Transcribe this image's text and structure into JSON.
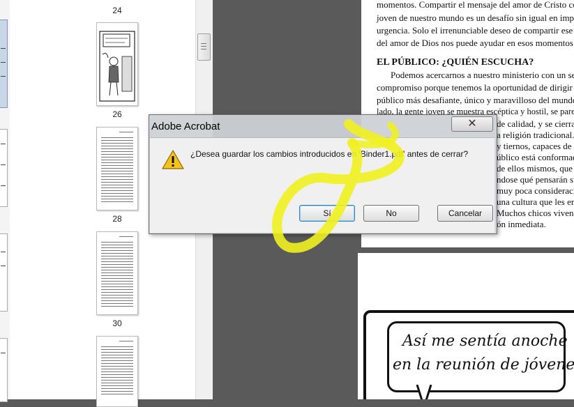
{
  "thumbnails": {
    "page_numbers": [
      "24",
      "26",
      "28",
      "30"
    ]
  },
  "document": {
    "top_lines": [
      "momentos. Compartir el mensaje del amor de Cristo con l",
      "joven de nuestro mundo es un desafío sin igual en import",
      "urgencia. Solo el irrenunciable deseo de compartir ese n",
      "del amor de Dios nos puede ayudar en esos momentos."
    ],
    "heading": "EL PÚBLICO: ¿QUIÉN ESCUCHA?",
    "body_lines": [
      "Podemos acercarnos a nuestro ministerio con un sent",
      "compromiso porque tenemos la oportunidad de dirigir",
      "público más desafiante, único y maravilloso del mundo.",
      "lado, la gente joven se muestra escéptica y hostil, se parec",
      "de calidad, y se cierra a la",
      "a religión tradicional. P",
      "y tiernos, capaces de un",
      "úblico está conformado p",
      "de ellos mismos, que pas",
      "ndose qué pensarán sus a",
      "muy poca consideración",
      "una cultura que les en",
      "Muchos chicos viven sol",
      "ón inmediata."
    ],
    "comic_line1": "Así me sentía anoche",
    "comic_line2": "en la reunión de jóvenes"
  },
  "dialog": {
    "title": "Adobe Acrobat",
    "close_symbol": "✕",
    "message": "¿Desea guardar los cambios introducidos en 'Binder1.pdf' antes de cerrar?",
    "buttons": {
      "yes": "Sí",
      "no": "No",
      "cancel": "Cancelar"
    }
  },
  "colors": {
    "annotation_highlight": "#f0f020",
    "warning": "#f5c21b"
  }
}
